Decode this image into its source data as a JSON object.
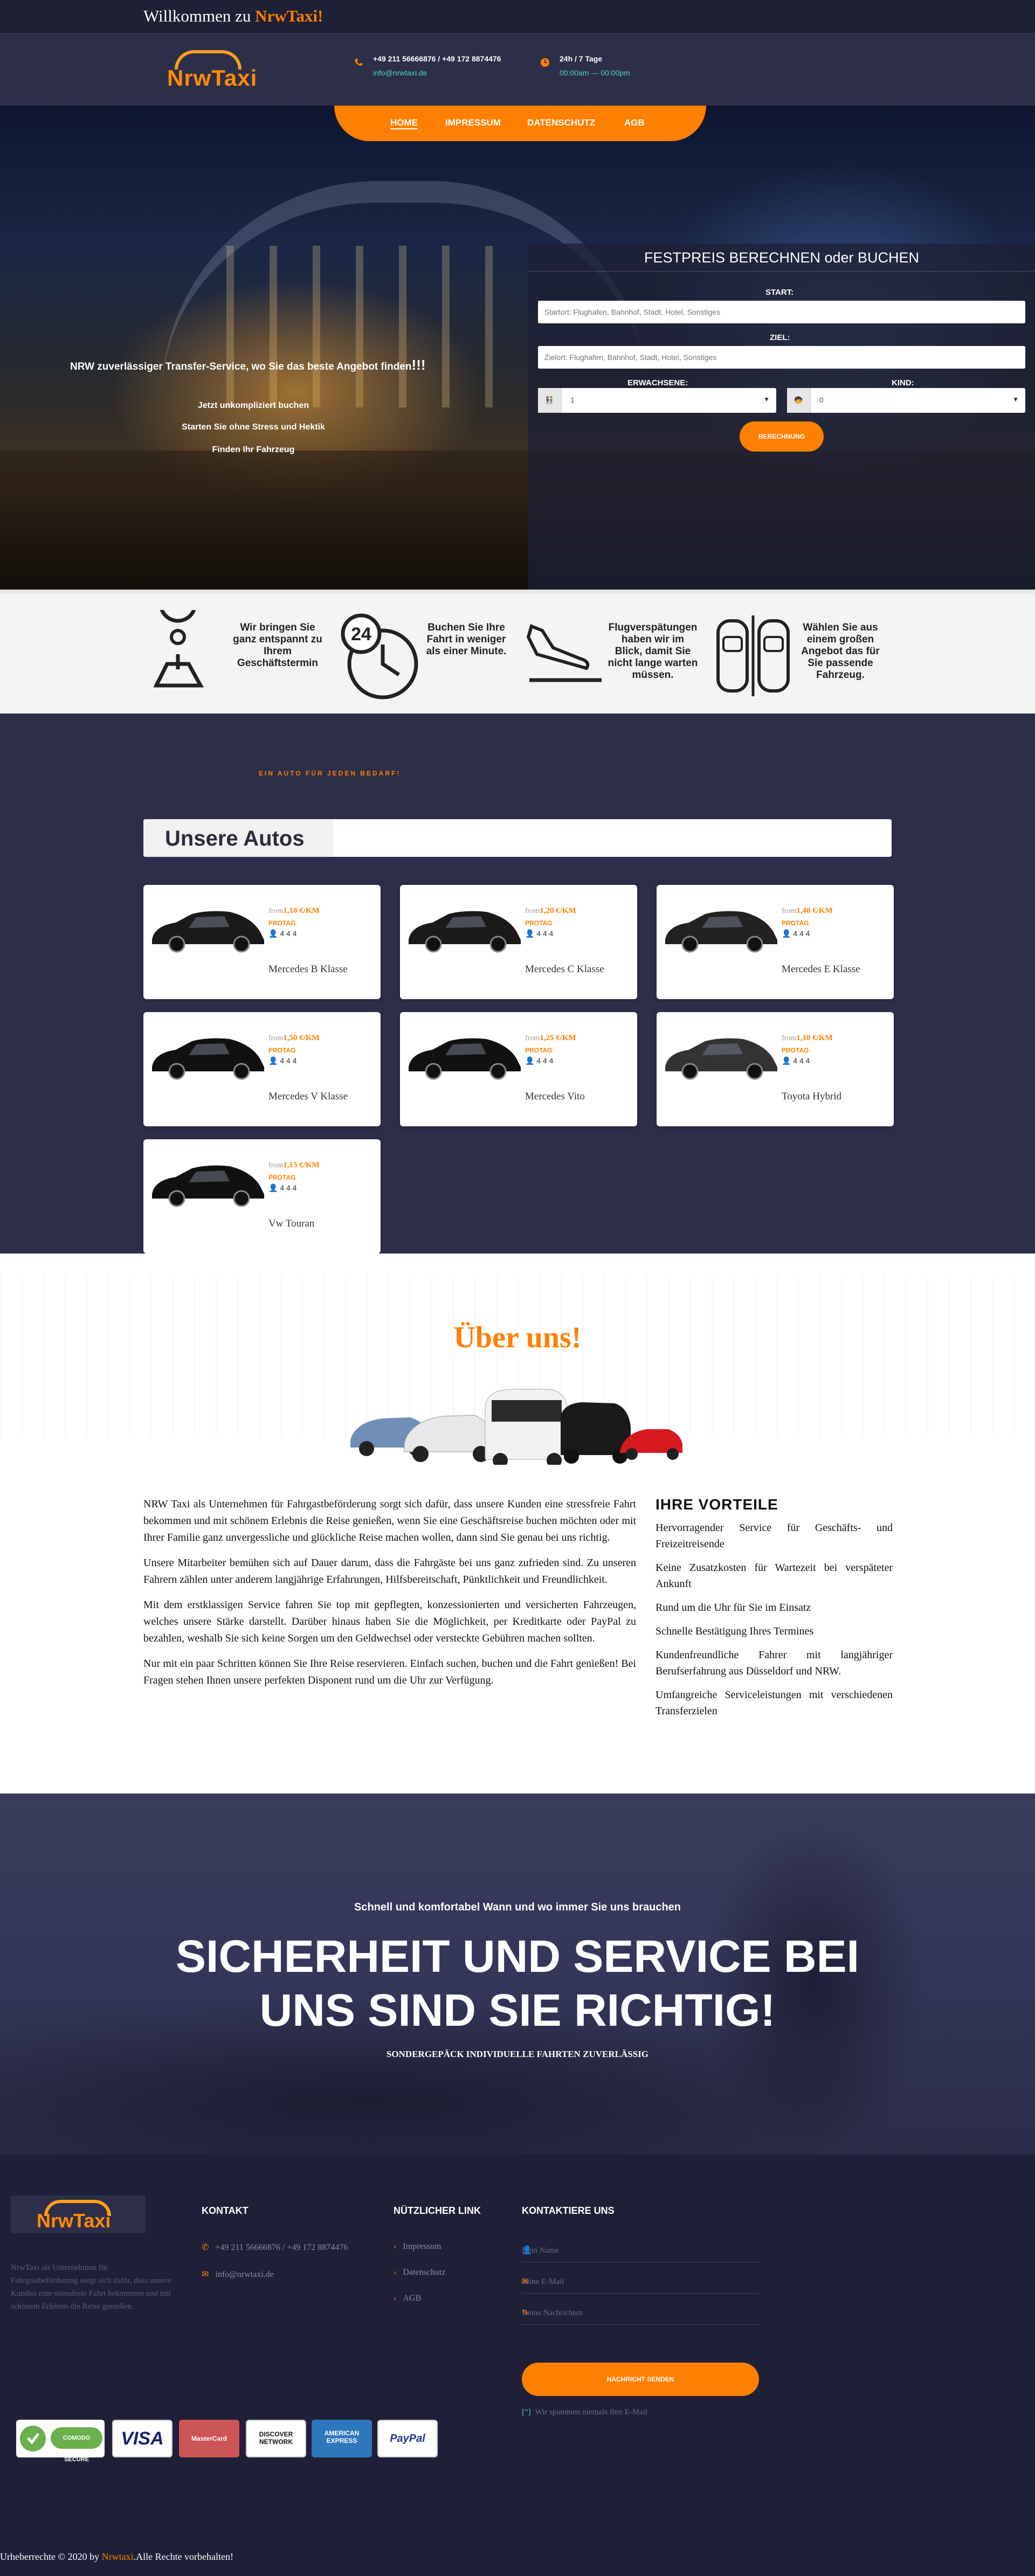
{
  "topbar": {
    "welcome": "Willkommen zu",
    "brand": "NrwTaxi!"
  },
  "header": {
    "logo": "NrwTaxi",
    "phone": "+49 211 56666876 / +49 172 8874476",
    "email": "info@nrwtaxi.de",
    "hours_label": "24h / 7 Tage",
    "hours": "00:00am — 00:00pm"
  },
  "nav": [
    {
      "label": "HOME"
    },
    {
      "label": "IMPRESSUM"
    },
    {
      "label": "DATENSCHUTZ"
    },
    {
      "label": "AGB"
    }
  ],
  "hero": {
    "tagline": "NRW zuverlässiger Transfer-Service, wo Sie das beste Angebot finden",
    "tagline_end": "!!!",
    "points": [
      "Jetzt unkompliziert buchen",
      "Starten Sie ohne Stress und Hektik",
      "Finden Ihr Fahrzeug"
    ]
  },
  "booking": {
    "title": "FESTPREIS BERECHNEN oder BUCHEN",
    "start_label": "START:",
    "start_placeholder": "Startort: Flughafen, Bahnhof, Stadt, Hotel, Sonstiges",
    "ziel_label": "ZIEL:",
    "ziel_placeholder": "Zielort: Flughafen, Bahnhof, Stadt, Hotel, Sonstiges",
    "adults_label": "ERWACHSENE:",
    "adults_prefix": "👫",
    "adults_value": "1",
    "kids_label": "KIND:",
    "kids_prefix": "🧒",
    "kids_value": "0",
    "button": "BERECHNUNG"
  },
  "features": [
    {
      "text": "Wir bringen Sie ganz entspannt zu Ihrem Geschäftstermin",
      "icon": "map-pin-icon"
    },
    {
      "text": "Buchen Sie Ihre Fahrt in weniger als einer Minute.",
      "icon": "clock-24-icon"
    },
    {
      "text": "Flugverspätungen haben wir im Blick, damit Sie nicht lange warten müssen.",
      "icon": "plane-landing-icon"
    },
    {
      "text": "Wählen Sie aus einem großen Angebot das für Sie passende Fahrzeug.",
      "icon": "cars-top-icon"
    }
  ],
  "cars": {
    "eyebrow": "EIN AUTO FÜR JEDEN BEDARF!",
    "title": "Unsere Autos",
    "items": [
      {
        "name": "Mercedes B Klasse",
        "from": "from",
        "price": "1,10 €",
        "unit": "/KM",
        "tag": "PROTAG",
        "specs": "4  4  4",
        "color": "#1a1a1a"
      },
      {
        "name": "Mercedes C Klasse",
        "from": "from",
        "price": "1,20 €",
        "unit": "/KM",
        "tag": "PROTAG",
        "specs": "4  4  4",
        "color": "#1a1a1a"
      },
      {
        "name": "Mercedes E Klasse",
        "from": "from",
        "price": "1,40 €",
        "unit": "/KM",
        "tag": "PROTAG",
        "specs": "4  4  4",
        "color": "#222"
      },
      {
        "name": "Mercedes V Klasse",
        "from": "from",
        "price": "1,50 €",
        "unit": "/KM",
        "tag": "PROTAG",
        "specs": "4  4  4",
        "color": "#111"
      },
      {
        "name": "Mercedes Vito",
        "from": "from",
        "price": "1,25 €",
        "unit": "/KM",
        "tag": "PROTAG",
        "specs": "4  4  4",
        "color": "#111"
      },
      {
        "name": "Toyota Hybrid",
        "from": "from",
        "price": "1,10 €",
        "unit": "/KM",
        "tag": "PROTAG",
        "specs": "4  4  4",
        "color": "#333"
      },
      {
        "name": "Vw Touran",
        "from": "from",
        "price": "1,15 €",
        "unit": "/KM",
        "tag": "PROTAG",
        "specs": "4  4  4",
        "color": "#111"
      }
    ]
  },
  "about": {
    "title": "Über uns!",
    "paragraphs": [
      "NRW Taxi als Unternehmen für Fahrgastbeförderung sorgt sich dafür, dass unsere Kunden eine stressfreie Fahrt bekommen und mit schönem Erlebnis die Reise genießen, wenn Sie eine Geschäftsreise buchen möchten oder mit Ihrer Familie ganz unvergessliche und glückliche Reise machen wollen, dann sind Sie genau bei uns richtig.",
      "Unsere Mitarbeiter bemühen sich auf Dauer darum, dass die Fahrgäste bei uns ganz zufrieden sind. Zu unseren Fahrern zählen unter anderem langjährige Erfahrungen, Hilfsbereitschaft, Pünktlichkeit und Freundlichkeit.",
      "Mit dem erstklassigen Service fahren Sie top mit gepflegten, konzessionierten und versicherten Fahrzeugen, welches unsere Stärke darstellt. Darüber hinaus haben Sie die Möglichkeit, per Kreditkarte oder PayPal zu bezahlen, weshalb Sie sich keine Sorgen um den Geldwechsel oder versteckte Gebühren machen sollten.",
      "Nur mit ein paar Schritten können Sie Ihre Reise reservieren. Einfach suchen, buchen und die Fahrt genießen! Bei Fragen stehen Ihnen unsere perfekten Disponent rund um die Uhr zur Verfügung."
    ],
    "advantages_title": "IHRE VORTEILE",
    "advantages": [
      "Hervorragender Service für Geschäfts- und Freizeitreisende",
      "Keine Zusatzkosten für Wartezeit bei verspäteter Ankunft",
      " Rund um die Uhr für Sie im Einsatz",
      "Schnelle Bestätigung Ihres Termines",
      "Kundenfreundliche Fahrer mit langjähriger Berufserfahrung aus Düsseldorf und NRW.",
      "Umfangreiche Serviceleistungen mit verschiedenen Transferzielen"
    ]
  },
  "safety": {
    "kicker": "Schnell und komfortabel Wann und wo immer Sie uns brauchen",
    "headline": "SICHERHEIT UND SERVICE BEI UNS SIND SIE RICHTIG!",
    "sub": "SONDERGEPÄCK INDIVIDUELLE FAHRTEN ZUVERLÄSSIG"
  },
  "footer": {
    "logo": "NrwTaxi",
    "about": "NrwTaxi als Unternehmen für Fahrgastbeförderung sorgt sich dafür, dass unsere Kunden eine stressfreie Fahrt bekommen und mit schönem Erlebnis die Reise genießen.",
    "kontakt_title": "KONTAKT",
    "phone": "+49 211 56666876 / +49 172 8874476",
    "email": "info@nrwtaxi.de",
    "links_title": "NÜTZLICHER LINK",
    "links": [
      "Impressum",
      "Datenschutz",
      "AGB"
    ],
    "contact_title": "KONTAKTIERE UNS",
    "name_placeholder": "Dein Name",
    "email_placeholder": "deine E-Mail",
    "message_placeholder": "Deine Nachrichten",
    "send": "NACHRICHT SENDEN",
    "note": "Wir spammen niemals Ihre E-Mail",
    "badges": [
      "COMODO SECURE",
      "VISA",
      "MasterCard",
      "DISCOVER NETWORK",
      "AMERICAN EXPRESS",
      "PayPal"
    ],
    "copyright_pre": "Urheberrechte © 2020 by",
    "copyright_brand": "Nrwtaxi",
    "copyright_post": ".Alle Rechte vorbehalten!"
  },
  "colors": {
    "accent": "#ff7f00",
    "navy": "#2d2e4a",
    "dark": "#1f2038",
    "teal": "#4fd1c5"
  }
}
